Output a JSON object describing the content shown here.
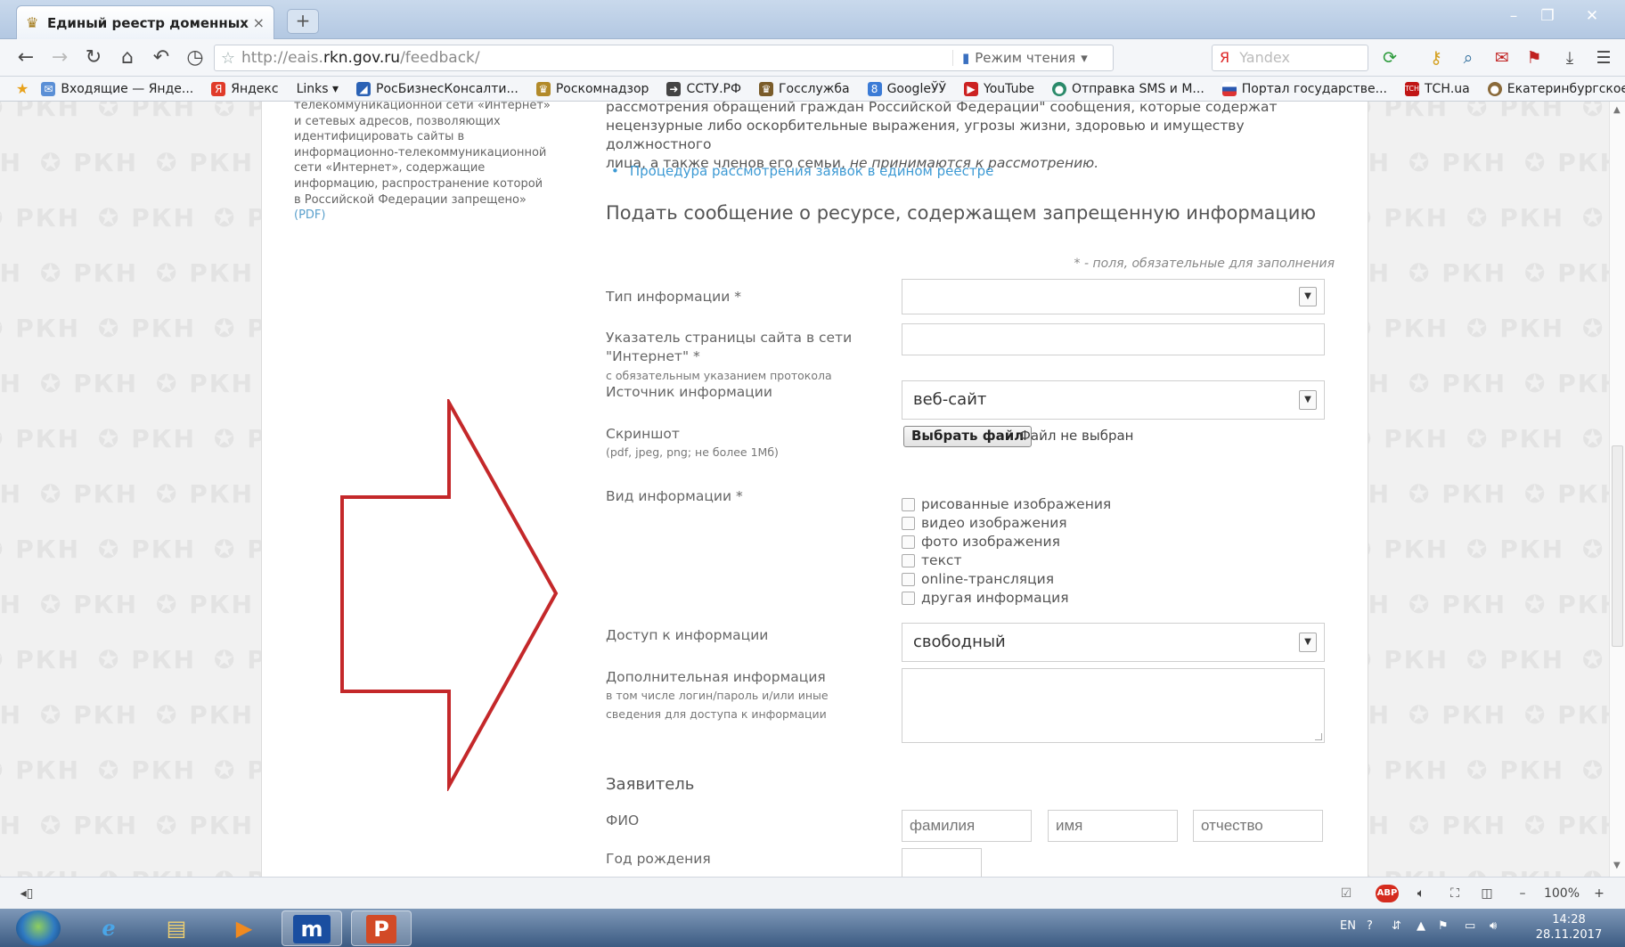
{
  "browser": {
    "tab_title": "Единый реестр доменных им...",
    "tab_close": "×",
    "new_tab": "+",
    "url_prefix": "http://eais.",
    "url_domain": "rkn.gov.ru",
    "url_path": "/feedback/",
    "reading_mode": "Режим чтения",
    "search_engine": "Я",
    "search_placeholder": "Yandex"
  },
  "bookmarks": [
    {
      "label": "Входящие — Янде...",
      "icon": "mail-icon",
      "color": "#5a8fd6"
    },
    {
      "label": "Яндекс",
      "icon": "yandex-icon",
      "color": "#e03b2a"
    },
    {
      "label": "Links ▾",
      "icon": "",
      "color": ""
    },
    {
      "label": "РосБизнесКонсалти...",
      "icon": "rbc-icon",
      "color": "#2b62b5"
    },
    {
      "label": "Роскомнадзор",
      "icon": "rkn-icon",
      "color": "#b28a2a"
    },
    {
      "label": "ССТУ.РФ",
      "icon": "sstu-icon",
      "color": "#444444"
    },
    {
      "label": "Госслужба",
      "icon": "gos-icon",
      "color": "#7a5c2a"
    },
    {
      "label": "GoogleЎЎ",
      "icon": "google-icon",
      "color": "#3b7bd6"
    },
    {
      "label": "YouTube",
      "icon": "youtube-icon",
      "color": "#cc2222"
    },
    {
      "label": "Отправка SMS и М...",
      "icon": "sms-icon",
      "color": "#2a8a6a"
    },
    {
      "label": "Портал государстве...",
      "icon": "portal-icon",
      "color": "#2a58b0"
    },
    {
      "label": "ТСН.ua",
      "icon": "tsn-icon",
      "color": "#c01515"
    },
    {
      "label": "Екатеринбургское",
      "icon": "ekb-icon",
      "color": "#8a6a3a"
    }
  ],
  "watermark": "РКН",
  "sidebar": {
    "text": "телекоммуникационной сети «Интернет» и сетевых адресов, позволяющих идентифицировать сайты в информационно-телекоммуникационной сети «Интернет», содержащие информацию, распространение которой в Российской Федерации запрещено»",
    "pdf": "(PDF)"
  },
  "intro": {
    "line1": "рассмотрения обращений граждан Российской Федерации\" сообщения, которые содержат",
    "line2": "нецензурные либо оскорбительные выражения, угрозы жизни, здоровью и имуществу должностного",
    "line3_plain": "лица, а также членов его семьи,",
    "line3_italic": "не принимаются к рассмотрению.",
    "procedure_link": "Процедура рассмотрения заявок в едином реестре"
  },
  "form": {
    "title": "Подать сообщение о ресурсе, содержащем запрещенную информацию",
    "required_note": "* - поля, обязательные для заполнения",
    "info_type_label": "Тип информации *",
    "info_type_value": "",
    "url_label_1": "Указатель страницы сайта в сети",
    "url_label_2": "\"Интернет\" *",
    "url_sublabel": "с обязательным указанием протокола",
    "source_label": "Источник информации",
    "source_value": "веб-сайт",
    "screenshot_label": "Скриншот",
    "screenshot_sublabel": "(pdf, jpeg, png; не более 1Мб)",
    "choose_file": "Выбрать файл",
    "file_status": "Файл не выбран",
    "kind_label": "Вид информации *",
    "kinds": [
      "рисованные изображения",
      "видео изображения",
      "фото изображения",
      "текст",
      "online-трансляция",
      "другая информация"
    ],
    "access_label": "Доступ к информации",
    "access_value": "свободный",
    "extra_label": "Дополнительная информация",
    "extra_sublabel_1": "в том числе логин/пароль и/или иные",
    "extra_sublabel_2": "сведения для доступа к информации",
    "applicant_title": "Заявитель",
    "fio_label": "ФИО",
    "surname_placeholder": "фамилия",
    "name_placeholder": "имя",
    "patronymic_placeholder": "отчество",
    "birth_year_label": "Год рождения"
  },
  "statusbar": {
    "zoom_minus": "–",
    "zoom": "100%",
    "zoom_plus": "+",
    "abp": "ABP"
  },
  "taskbar": {
    "lang": "EN",
    "time": "14:28",
    "date": "28.11.2017"
  },
  "colors": {
    "link": "#3d9ad4",
    "arrow": "#c4282a"
  }
}
